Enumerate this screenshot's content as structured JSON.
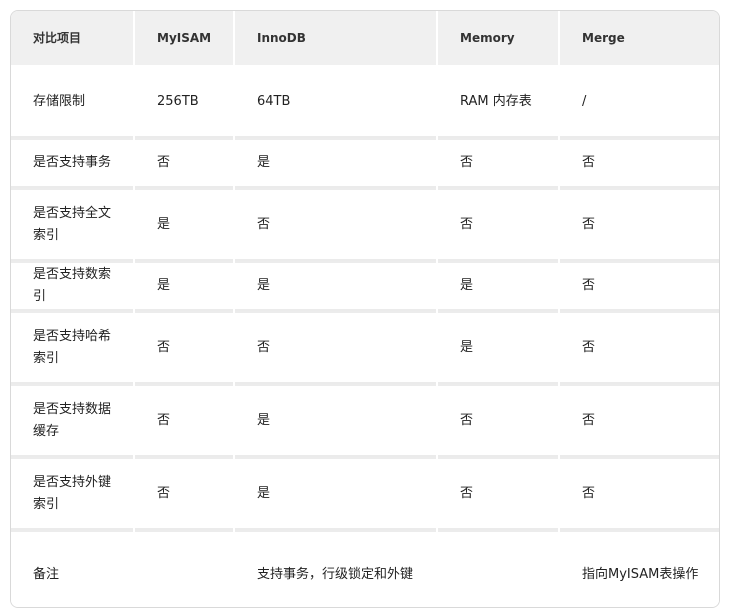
{
  "table": {
    "headers": [
      "对比项目",
      "MyISAM",
      "InnoDB",
      "Memory",
      "Merge"
    ],
    "rows": [
      [
        "存储限制",
        "256TB",
        "64TB",
        "RAM 内存表",
        "/"
      ],
      [
        "是否支持事务",
        "否",
        "是",
        "否",
        "否"
      ],
      [
        "是否支持全文索引",
        "是",
        "否",
        "否",
        "否"
      ],
      [
        "是否支持数索引",
        "是",
        "是",
        "是",
        "否"
      ],
      [
        "是否支持哈希索引",
        "否",
        "否",
        "是",
        "否"
      ],
      [
        "是否支持数据缓存",
        "否",
        "是",
        "否",
        "否"
      ],
      [
        "是否支持外键索引",
        "否",
        "是",
        "否",
        "否"
      ],
      [
        "备注",
        "",
        "支持事务，行级锁定和外键",
        "",
        "指向MyISAM表操作"
      ]
    ]
  }
}
